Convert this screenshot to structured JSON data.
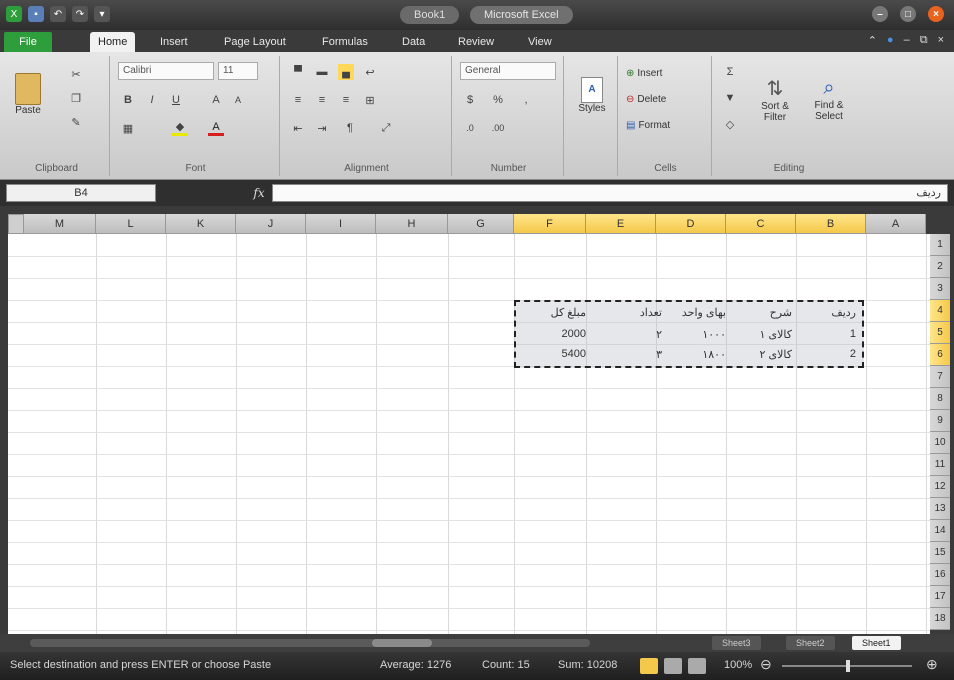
{
  "titlebar": {
    "title": "Book1",
    "app_tag": "Microsoft Excel"
  },
  "ribbon_tabs": [
    "File",
    "Home",
    "Insert",
    "Page Layout",
    "Formulas",
    "Data",
    "Review",
    "View"
  ],
  "active_tab": "Home",
  "ribbon": {
    "clipboard": {
      "label": "Clipboard",
      "paste": "Paste"
    },
    "font": {
      "label": "Font",
      "name": "Calibri",
      "size": "11"
    },
    "alignment": {
      "label": "Alignment"
    },
    "number": {
      "label": "Number",
      "format": "General"
    },
    "styles": {
      "label": "Styles"
    },
    "cells": {
      "label": "Cells",
      "insert": "Insert",
      "delete": "Delete",
      "format": "Format"
    },
    "editing": {
      "label": "Editing",
      "sort": "Sort &",
      "sort2": "Filter",
      "find": "Find &",
      "find2": "Select"
    }
  },
  "formula_bar": {
    "name_box": "B4",
    "fx": "fx",
    "formula": "ردیف"
  },
  "columns": [
    "M",
    "L",
    "K",
    "J",
    "I",
    "H",
    "G",
    "F",
    "E",
    "D",
    "C",
    "B",
    "A"
  ],
  "selected_columns": [
    "F",
    "E",
    "D",
    "C",
    "B"
  ],
  "rows": [
    "1",
    "2",
    "3",
    "4",
    "5",
    "6",
    "7",
    "8",
    "9",
    "10",
    "11",
    "12",
    "13",
    "14",
    "15",
    "16",
    "17",
    "18"
  ],
  "selected_rows": [
    "4",
    "5",
    "6"
  ],
  "table": {
    "headers": [
      "ردیف",
      "شرح",
      "بهای واحد",
      "تعداد",
      "مبلغ کل"
    ],
    "rows": [
      [
        "1",
        "کالای ۱",
        "۱۰۰۰",
        "۲",
        "2000"
      ],
      [
        "2",
        "کالای ۲",
        "۱۸۰۰",
        "۳",
        "5400"
      ]
    ]
  },
  "sheet_tabs": [
    "Sheet3",
    "Sheet2",
    "Sheet1"
  ],
  "active_sheet": "Sheet1",
  "status": {
    "message": "Select destination and press ENTER or choose Paste",
    "average": "Average: 1276",
    "count": "Count: 15",
    "sum": "Sum: 10208",
    "zoom": "100%"
  },
  "colors": {
    "file_tab": "#2e9e3c",
    "selected_header": "#f4c84a",
    "range_border": "#222222"
  }
}
